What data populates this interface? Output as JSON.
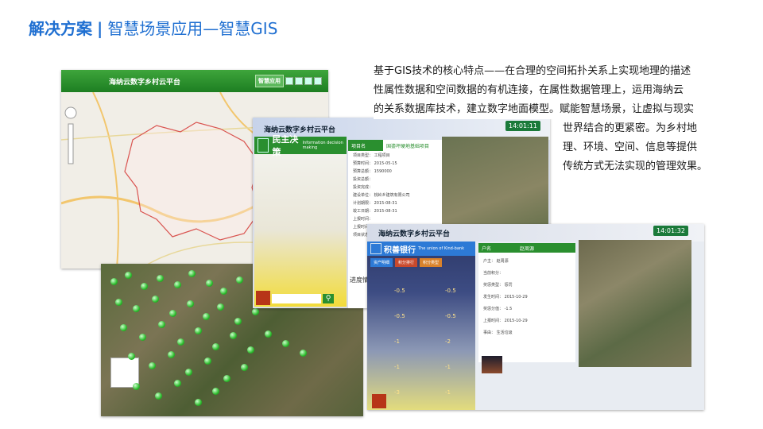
{
  "slide": {
    "title_main": "解决方案",
    "title_sep": "|",
    "title_sub": "智慧场景应用—智慧GIS"
  },
  "description": {
    "lines": [
      "基于GIS技术的核心特点——在合理的空间拓扑关系上实现地理的描述",
      "性属性数据和空间数据的有机连接，在属性数据管理上，运用海纳云",
      "的关系数据库技术，建立数字地面模型。赋能智慧场景，让虚拟与现实",
      "世界结合的更紧密。为乡村地",
      "理、环境、空间、信息等提供",
      "传统方式无法实现的管理效果。"
    ]
  },
  "map_shot": {
    "platform": "海纳云数字乡村云平台",
    "app_button": "智慧应用"
  },
  "decision_shot": {
    "platform": "海纳云数字乡村云平台",
    "clock": "14:01:11",
    "panel_title": "民主决策",
    "panel_subtitle": "Information decision making",
    "form_header": [
      "项目名",
      "国鎏坪硬地基础项目"
    ],
    "form_rows": [
      "项目类型：  工程项目",
      "预算时间：  2015-05-15",
      "预算总额：  1590000",
      "投资总额：",
      "投资完成：",
      "建设单位：  桃岭乡建筑有限公司",
      "计划期限：  2015-08-31",
      "竣工日期：  2015-08-31",
      "上报时间：",
      "上报时间：",
      "项目状态："
    ],
    "bottom_label": "进度情"
  },
  "bank_shot": {
    "platform": "海纳云数字乡村云平台",
    "clock": "14:01:32",
    "panel_title": "积善银行",
    "panel_subtitle": "The union of Kind-bank",
    "buttons": [
      "资产明细",
      "积分排行",
      "积分类型"
    ],
    "values": [
      "-0.5",
      "-0.5",
      "-0.5",
      "-0.5",
      "-1",
      "-2",
      "-1",
      "-1",
      "-3",
      "-1"
    ],
    "form_header": [
      "户名",
      "赵周源"
    ],
    "form_rows": [
      "户主：  赵周源",
      "当前积分：",
      "奖惩类型：  惩罚",
      "发生时间：  2015-10-29",
      "奖惩分值：  -1.5",
      "上报时间：  2015-10-29",
      "事由：  生活垃圾"
    ]
  },
  "colors": {
    "title_blue": "#1f6fd1",
    "gis_green": "#2a8f2f",
    "bank_blue": "#2d7ad6",
    "home_red": "#b73518"
  }
}
